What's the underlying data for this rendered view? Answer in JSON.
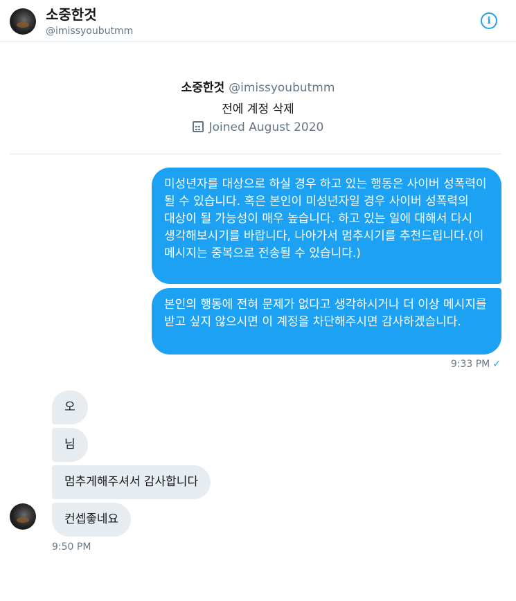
{
  "header": {
    "name": "소중한것",
    "handle": "@imissyoubutmm",
    "info_icon": "info-icon"
  },
  "profile": {
    "name": "소중한것",
    "handle": "@imissyoubutmm",
    "bio": "전에 계정 삭제",
    "joined": "Joined August 2020"
  },
  "messages": {
    "outgoing": [
      "미성년자를 대상으로 하실 경우 하고 있는 행동은 사이버 성폭력이 될 수 있습니다. 혹은 본인이 미성년자일 경우 사이버 성폭력의 대상이 될 가능성이 매우 높습니다. 하고 있는 일에 대해서 다시 생각해보시기를 바랍니다, 나아가서 멈추시기를 추천드립니다.(이 메시지는 중복으로 전송될 수 있습니다.)",
      "본인의 행동에 전혀 문제가 없다고 생각하시거나 더 이상 메시지를 받고 싶지 않으시면 이 계정을 차단해주시면 감사하겠습니다."
    ],
    "outgoing_time": "9:33 PM",
    "outgoing_check": "✓",
    "incoming": [
      "오",
      "님",
      "멈추게해주셔서 감사합니다",
      "컨셉좋네요"
    ],
    "incoming_time": "9:50 PM"
  },
  "colors": {
    "accent": "#1da1f2",
    "incoming_bubble": "#e6ecf0",
    "muted_text": "#657786"
  }
}
